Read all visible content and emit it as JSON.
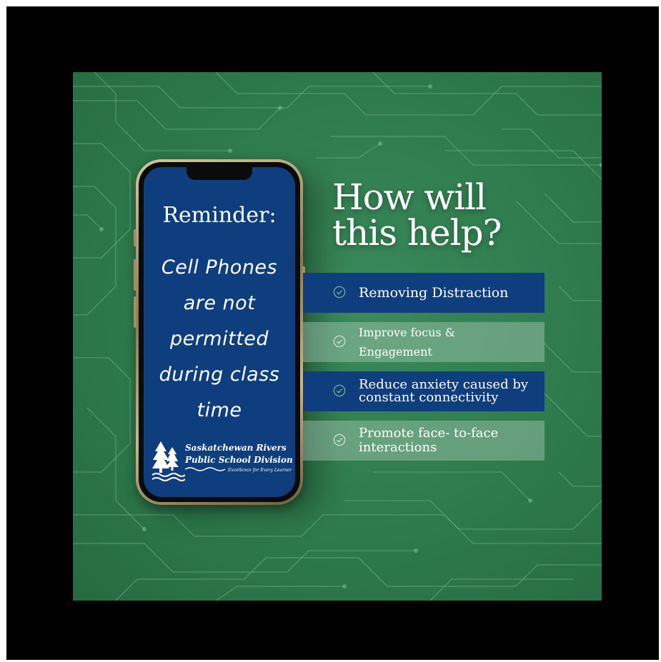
{
  "phone_screen": {
    "title": "Reminder:",
    "message_lines": [
      "Cell Phones",
      "are not",
      "permitted",
      "during class",
      "time"
    ]
  },
  "logo": {
    "name_line1": "Saskatchewan Rivers",
    "name_line2": "Public School Division",
    "tagline": "Excellence for Every Learner",
    "icon": "pine-trees-river-logo"
  },
  "headline": {
    "line1": "How will",
    "line2": "this help?"
  },
  "benefits": [
    {
      "label": "Removing Distraction",
      "icon": "check-circle-icon"
    },
    {
      "label": "Improve focus & Engagement",
      "icon": "check-circle-icon"
    },
    {
      "label": "Reduce anxiety caused by constant connectivity",
      "icon": "check-circle-icon"
    },
    {
      "label": "Promote face- to-face interactions",
      "icon": "check-circle-icon"
    }
  ],
  "colors": {
    "background_green": "#2e7a4c",
    "screen_blue": "#0f3e7e",
    "light_band": "#8fb9a0",
    "frame": "#000000"
  }
}
